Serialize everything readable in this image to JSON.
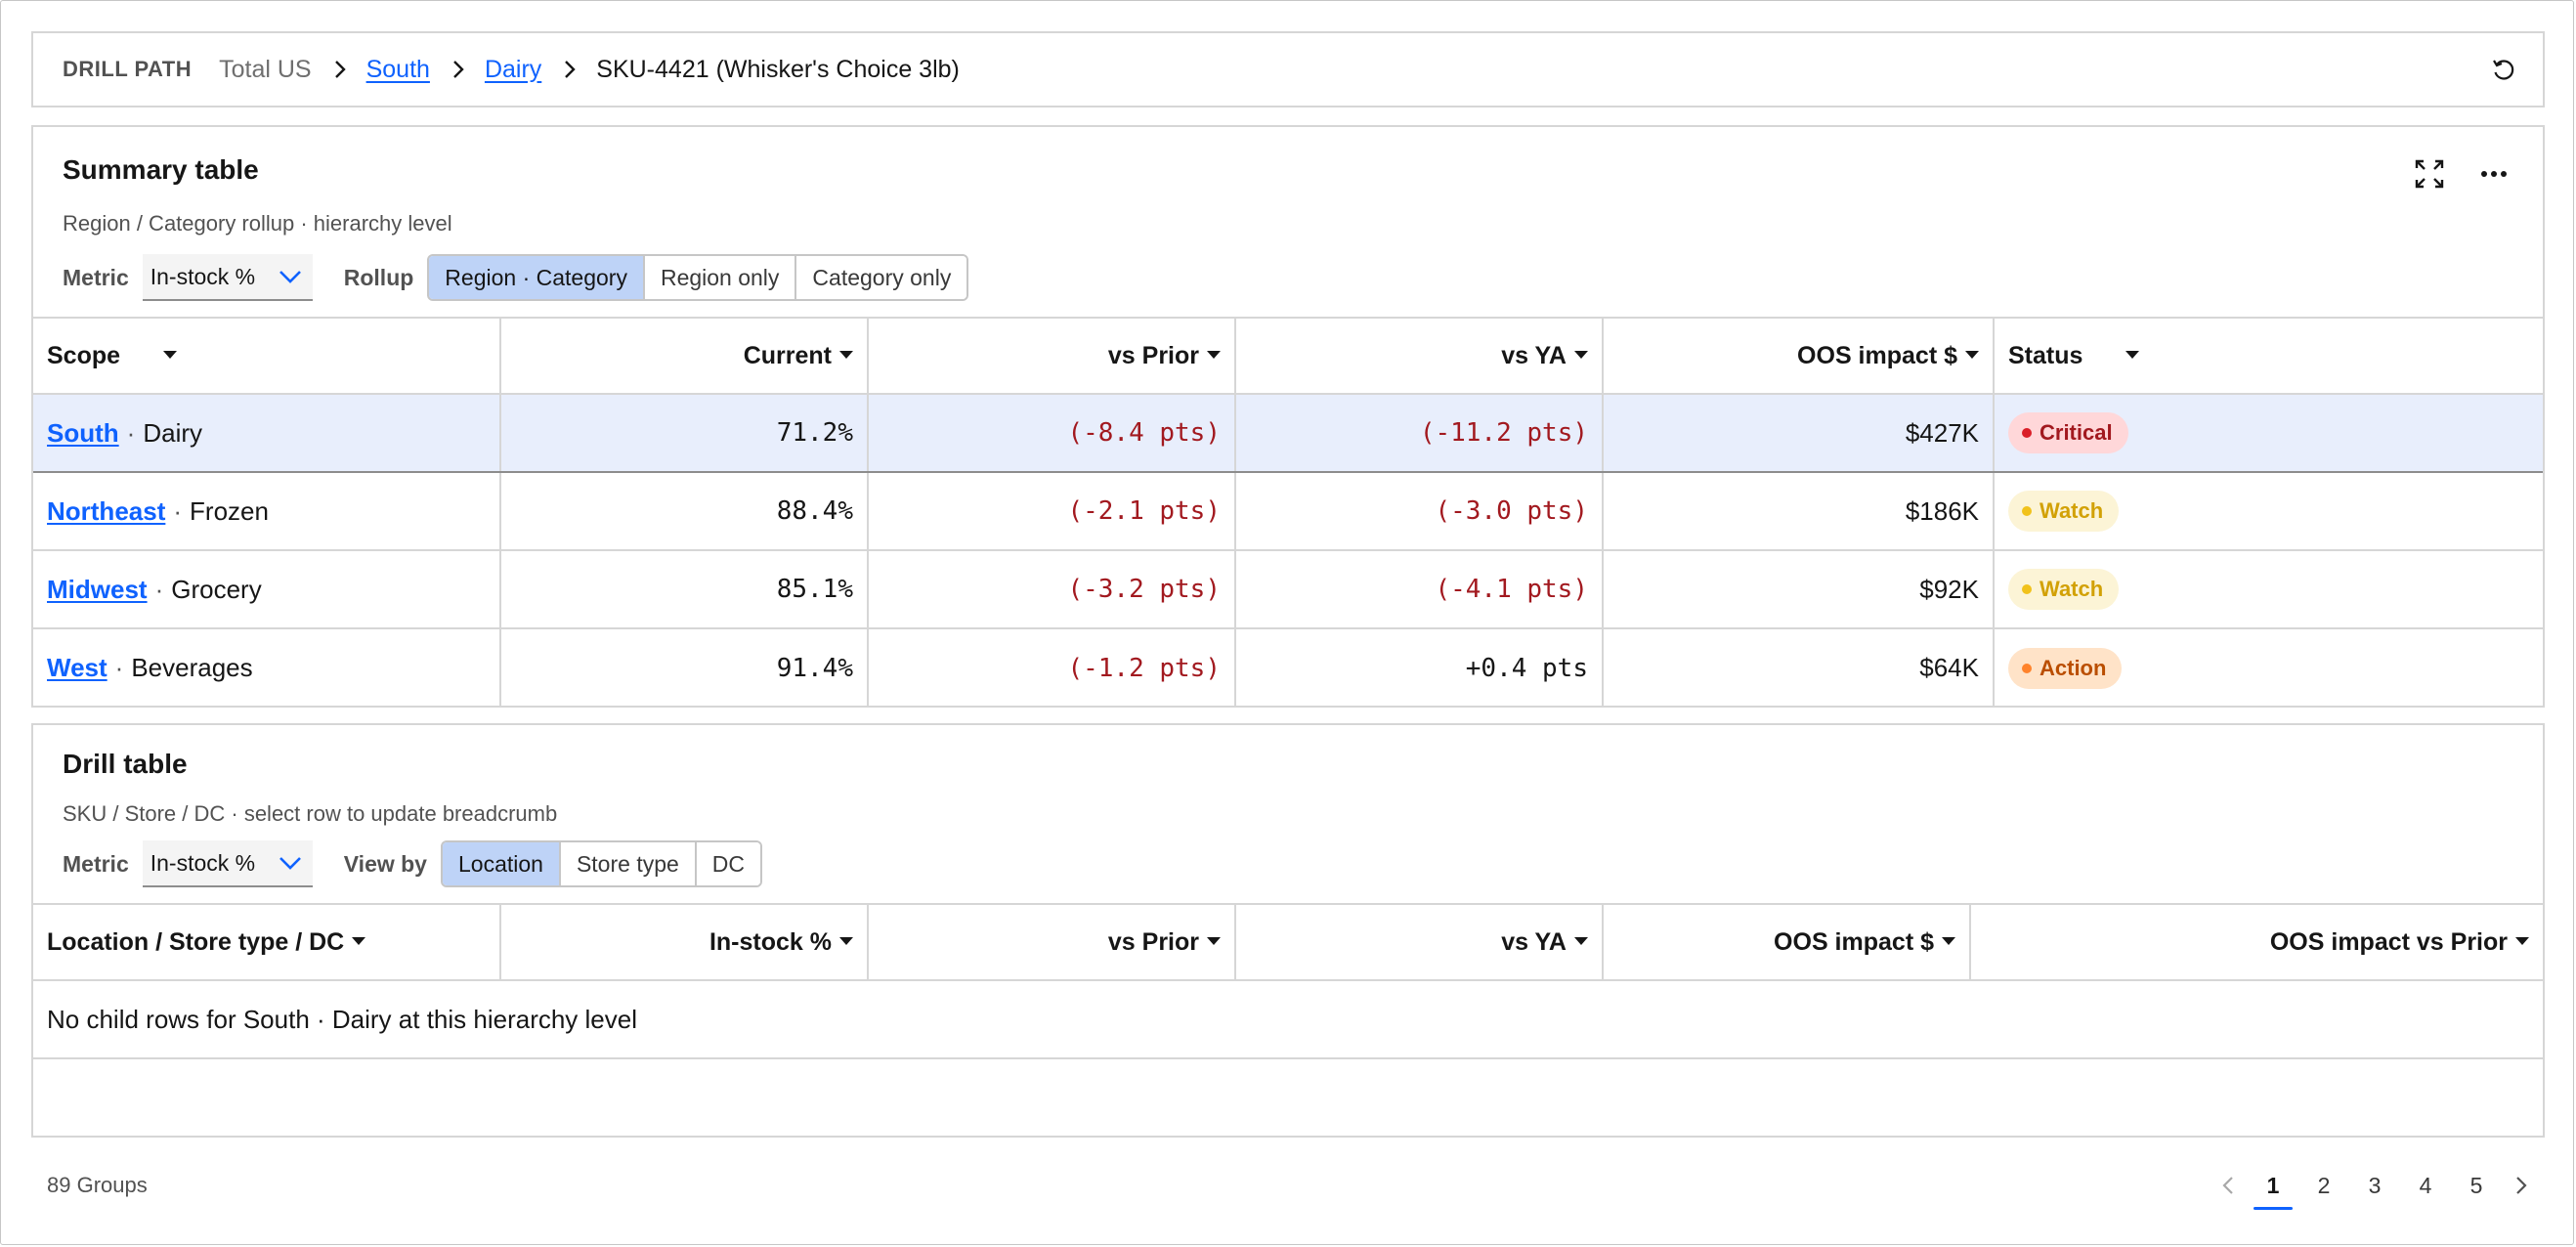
{
  "breadcrumb": {
    "label": "DRILL PATH",
    "items": [
      {
        "text": "Total US",
        "kind": "plain"
      },
      {
        "text": "South",
        "kind": "link"
      },
      {
        "text": "Dairy",
        "kind": "link"
      },
      {
        "text": "SKU-4421 (Whisker's Choice 3lb)",
        "kind": "current"
      }
    ],
    "reset_icon": "reset-icon"
  },
  "summary": {
    "title": "Summary table",
    "subtitle": "Region / Category rollup · hierarchy level",
    "metric_label": "Metric",
    "metric_value": "In-stock %",
    "rollup_label": "Rollup",
    "rollup_options": [
      "Region · Category",
      "Region only",
      "Category only"
    ],
    "rollup_selected": 0,
    "columns": [
      "Scope",
      "Current",
      "vs Prior",
      "vs YA",
      "OOS impact $",
      "Status"
    ],
    "rows": [
      {
        "region": "South",
        "category": "Dairy",
        "current": "71.2%",
        "vs_prior": "(-8.4 pts)",
        "vs_ya": "(-11.2 pts)",
        "oos": "$427K",
        "status": "Critical",
        "selected": true
      },
      {
        "region": "Northeast",
        "category": "Frozen",
        "current": "88.4%",
        "vs_prior": "(-2.1 pts)",
        "vs_ya": "(-3.0 pts)",
        "oos": "$186K",
        "status": "Watch",
        "selected": false
      },
      {
        "region": "Midwest",
        "category": "Grocery",
        "current": "85.1%",
        "vs_prior": "(-3.2 pts)",
        "vs_ya": "(-4.1 pts)",
        "oos": "$92K",
        "status": "Watch",
        "selected": false
      },
      {
        "region": "West",
        "category": "Beverages",
        "current": "91.4%",
        "vs_prior": "(-1.2 pts)",
        "vs_ya": "+0.4 pts",
        "oos": "$64K",
        "status": "Action",
        "selected": false
      }
    ]
  },
  "drill": {
    "title": "Drill table",
    "subtitle": "SKU / Store / DC · select row to update breadcrumb",
    "metric_label": "Metric",
    "metric_value": "In-stock %",
    "viewby_label": "View by",
    "viewby_options": [
      "Location",
      "Store type",
      "DC"
    ],
    "viewby_selected": 0,
    "columns": [
      "Location / Store type / DC",
      "In-stock %",
      "vs Prior",
      "vs YA",
      "OOS impact $",
      "OOS impact vs Prior"
    ],
    "empty_message": "No child rows for South · Dairy at this hierarchy level"
  },
  "footer": {
    "groups": "89 Groups",
    "pages": [
      "1",
      "2",
      "3",
      "4",
      "5"
    ],
    "current_page": "1"
  },
  "colors": {
    "link": "#0f62fe",
    "negative": "#a2191f",
    "selected_row": "#e8eefc",
    "segment_on": "#bed3f7",
    "critical": "#da1e28",
    "watch": "#f1c21b",
    "action": "#ff832b"
  }
}
